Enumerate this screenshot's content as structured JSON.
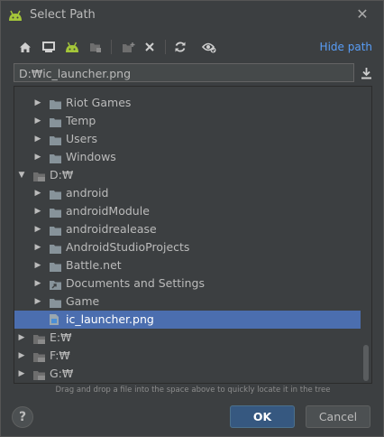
{
  "window": {
    "title": "Select Path",
    "close_glyph": "✕"
  },
  "toolbar": {
    "icons": [
      "home-icon",
      "desktop-icon",
      "android-project-icon",
      "module-icon",
      "new-folder-icon",
      "delete-icon",
      "refresh-icon",
      "show-hidden-icon"
    ],
    "hide_path_label": "Hide path"
  },
  "path": {
    "value": "D:₩ic_launcher.png"
  },
  "tree": {
    "rows": [
      {
        "label": "Riot Games",
        "type": "folder",
        "expanded": false
      },
      {
        "label": "Temp",
        "type": "folder",
        "expanded": false
      },
      {
        "label": "Users",
        "type": "folder",
        "expanded": false
      },
      {
        "label": "Windows",
        "type": "folder",
        "expanded": false
      },
      {
        "label": "D:₩",
        "type": "drive",
        "expanded": true
      },
      {
        "label": "android",
        "type": "folder",
        "expanded": false
      },
      {
        "label": "androidModule",
        "type": "folder",
        "expanded": false
      },
      {
        "label": "androidrealease",
        "type": "folder",
        "expanded": false
      },
      {
        "label": "AndroidStudioProjects",
        "type": "folder",
        "expanded": false
      },
      {
        "label": "Battle.net",
        "type": "folder",
        "expanded": false
      },
      {
        "label": "Documents and Settings",
        "type": "folder-link",
        "expanded": false
      },
      {
        "label": "Game",
        "type": "folder",
        "expanded": false
      },
      {
        "label": "ic_launcher.png",
        "type": "file",
        "selected": true
      },
      {
        "label": "E:₩",
        "type": "drive",
        "expanded": false
      },
      {
        "label": "F:₩",
        "type": "drive",
        "expanded": false
      },
      {
        "label": "G:₩",
        "type": "drive",
        "expanded": false
      }
    ]
  },
  "hint": "Drag and drop a file into the space above to quickly locate it in the tree",
  "buttons": {
    "help": "?",
    "ok": "OK",
    "cancel": "Cancel"
  },
  "colors": {
    "background": "#3c3f41",
    "selection": "#4b6eaf",
    "link": "#589df6",
    "android_green": "#a4c639",
    "primary_button": "#365880"
  }
}
